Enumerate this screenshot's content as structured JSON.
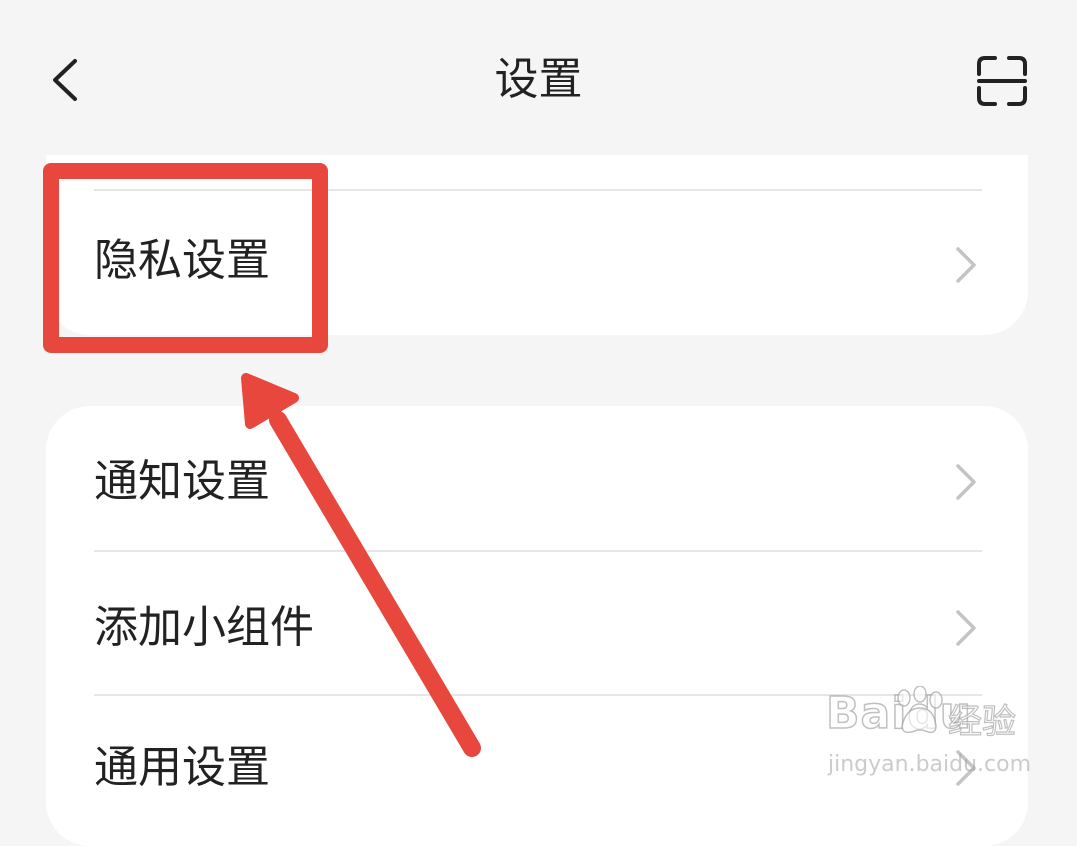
{
  "header": {
    "title": "设置",
    "back_icon": "chevron-left-icon",
    "scan_icon": "scan-icon"
  },
  "sections": [
    {
      "items": [
        {
          "label": "隐私设置",
          "icon": "chevron-right-icon"
        }
      ]
    },
    {
      "items": [
        {
          "label": "通知设置",
          "icon": "chevron-right-icon"
        },
        {
          "label": "添加小组件",
          "icon": "chevron-right-icon"
        },
        {
          "label": "通用设置",
          "icon": "chevron-right-icon"
        }
      ]
    }
  ],
  "annotation": {
    "color": "#e8473d",
    "highlight_target": "隐私设置"
  },
  "watermark": {
    "brand": "Baidu",
    "suffix": "经验",
    "url": "jingyan.baidu.com"
  },
  "colors": {
    "background": "#f5f5f5",
    "card": "#ffffff",
    "text": "#222222",
    "chevron": "#c4c4c4",
    "divider": "#e6e6e6"
  }
}
